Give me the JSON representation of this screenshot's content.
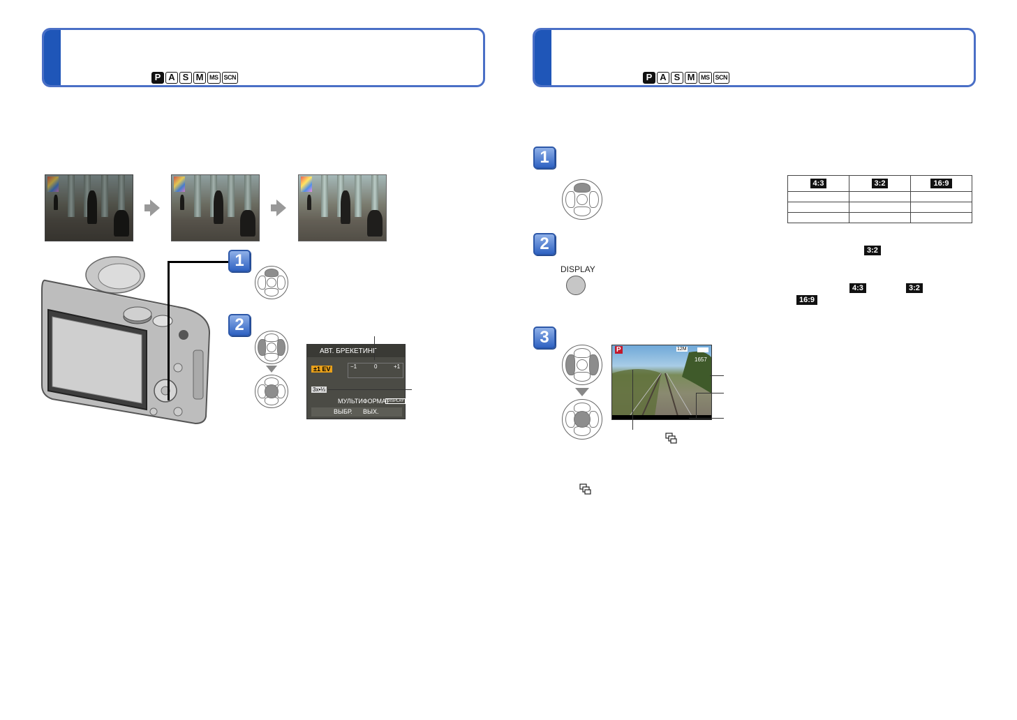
{
  "left_page": {
    "mode_icons": [
      "P",
      "A",
      "S",
      "M",
      "MS",
      "SCN"
    ],
    "step1": "1",
    "step2": "2",
    "lcd": {
      "menu_title": "АВТ. БРЕКЕТИНГ",
      "ev_value": "±1",
      "ev_unit": "EV",
      "scale_minus": "−1",
      "scale_zero": "0",
      "scale_plus": "+1",
      "frames_label": "3x•⅓",
      "multiformat_label": "МУЛЬТИФОРМАТ",
      "display_tag": "DISPLAY",
      "select_exit": "ВЫБР.",
      "exit_label": "ВЫХ."
    }
  },
  "right_page": {
    "mode_icons": [
      "P",
      "A",
      "S",
      "M",
      "MS",
      "SCN"
    ],
    "step1": "1",
    "step2": "2",
    "step3": "3",
    "aspect_table": {
      "headers": [
        "4:3",
        "3:2",
        "16:9"
      ],
      "rows": [
        [
          "",
          "",
          ""
        ],
        [
          "",
          "",
          ""
        ],
        [
          "",
          "",
          ""
        ]
      ]
    },
    "badge_32_a": "3:2",
    "badge_43": "4:3",
    "badge_32_b": "3:2",
    "badge_169": "16:9",
    "display_button_label": "DISPLAY",
    "lcd_mode": "P",
    "lcd_size": "12M",
    "lcd_count": "1657"
  },
  "colors": {
    "accent_blue": "#1f56b8",
    "frame_blue": "#4a6fc6"
  }
}
